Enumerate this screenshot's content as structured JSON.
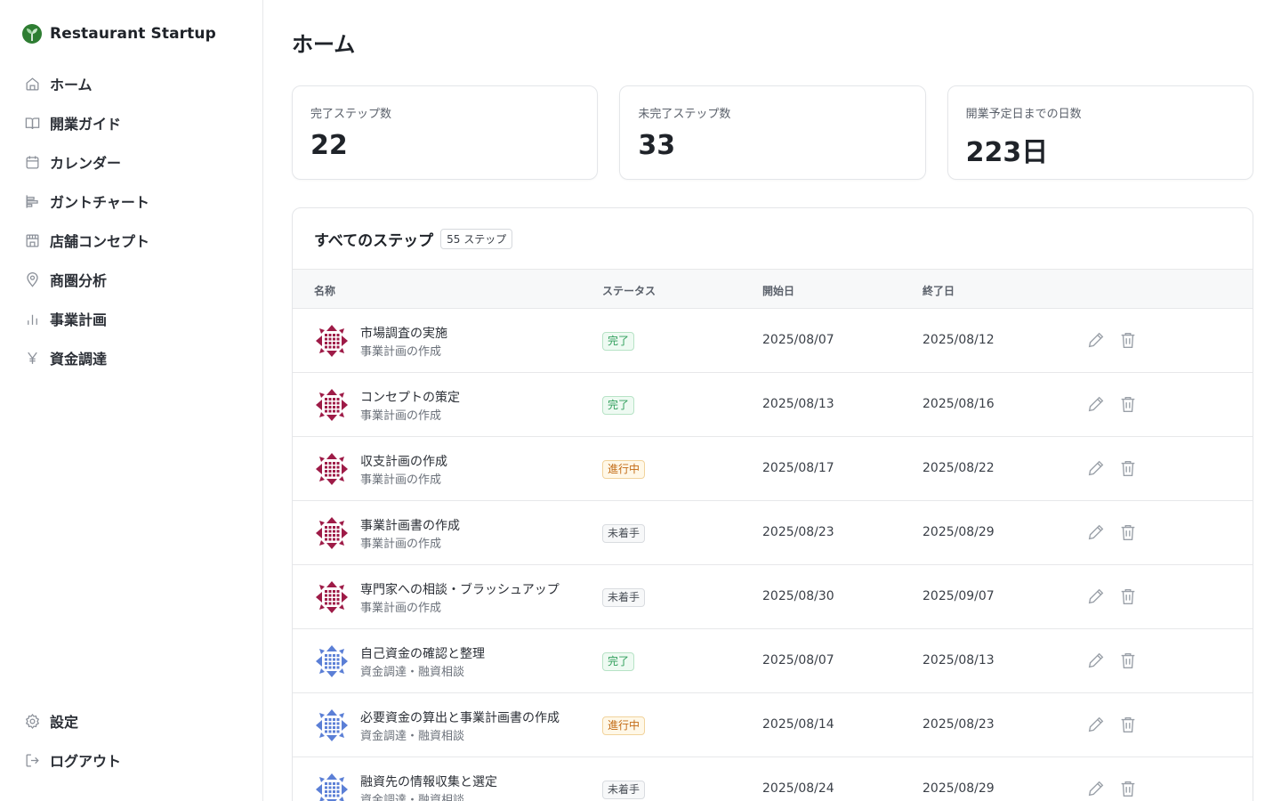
{
  "brand": {
    "name": "Restaurant Startup",
    "logo_icon": "leaf-globe-icon"
  },
  "sidebar": {
    "items": [
      {
        "label": "ホーム",
        "icon": "home-icon"
      },
      {
        "label": "開業ガイド",
        "icon": "book-icon"
      },
      {
        "label": "カレンダー",
        "icon": "calendar-icon"
      },
      {
        "label": "ガントチャート",
        "icon": "gantt-icon"
      },
      {
        "label": "店舗コンセプト",
        "icon": "store-icon"
      },
      {
        "label": "商圏分析",
        "icon": "map-pin-icon"
      },
      {
        "label": "事業計画",
        "icon": "bar-chart-icon"
      },
      {
        "label": "資金調達",
        "icon": "yen-icon"
      }
    ],
    "bottom": [
      {
        "label": "設定",
        "icon": "gear-icon"
      },
      {
        "label": "ログアウト",
        "icon": "logout-icon"
      }
    ]
  },
  "page": {
    "title": "ホーム"
  },
  "stats": [
    {
      "label": "完了ステップ数",
      "value": "22"
    },
    {
      "label": "未完了ステップ数",
      "value": "33"
    },
    {
      "label": "開業予定日までの日数",
      "value": "223日"
    }
  ],
  "steps": {
    "title": "すべてのステップ",
    "count": "55 ステップ",
    "columns": {
      "name": "名称",
      "status": "ステータス",
      "start": "開始日",
      "end": "終了日"
    },
    "rows": [
      {
        "name": "市場調査の実施",
        "category": "事業計画の作成",
        "status": "完了",
        "status_kind": "done",
        "start": "2025/08/07",
        "end": "2025/08/12",
        "avatar_color": "#9e1b47"
      },
      {
        "name": "コンセプトの策定",
        "category": "事業計画の作成",
        "status": "完了",
        "status_kind": "done",
        "start": "2025/08/13",
        "end": "2025/08/16",
        "avatar_color": "#9e1b47"
      },
      {
        "name": "収支計画の作成",
        "category": "事業計画の作成",
        "status": "進行中",
        "status_kind": "prog",
        "start": "2025/08/17",
        "end": "2025/08/22",
        "avatar_color": "#9e1b47"
      },
      {
        "name": "事業計画書の作成",
        "category": "事業計画の作成",
        "status": "未着手",
        "status_kind": "todo",
        "start": "2025/08/23",
        "end": "2025/08/29",
        "avatar_color": "#9e1b47"
      },
      {
        "name": "専門家への相談・ブラッシュアップ",
        "category": "事業計画の作成",
        "status": "未着手",
        "status_kind": "todo",
        "start": "2025/08/30",
        "end": "2025/09/07",
        "avatar_color": "#9e1b47"
      },
      {
        "name": "自己資金の確認と整理",
        "category": "資金調達・融資相談",
        "status": "完了",
        "status_kind": "done",
        "start": "2025/08/07",
        "end": "2025/08/13",
        "avatar_color": "#5b7fd6"
      },
      {
        "name": "必要資金の算出と事業計画書の作成",
        "category": "資金調達・融資相談",
        "status": "進行中",
        "status_kind": "prog",
        "start": "2025/08/14",
        "end": "2025/08/23",
        "avatar_color": "#5b7fd6"
      },
      {
        "name": "融資先の情報収集と選定",
        "category": "資金調達・融資相談",
        "status": "未着手",
        "status_kind": "todo",
        "start": "2025/08/24",
        "end": "2025/08/29",
        "avatar_color": "#5b7fd6"
      }
    ]
  },
  "actions": {
    "edit_icon": "pencil-icon",
    "delete_icon": "trash-icon"
  }
}
